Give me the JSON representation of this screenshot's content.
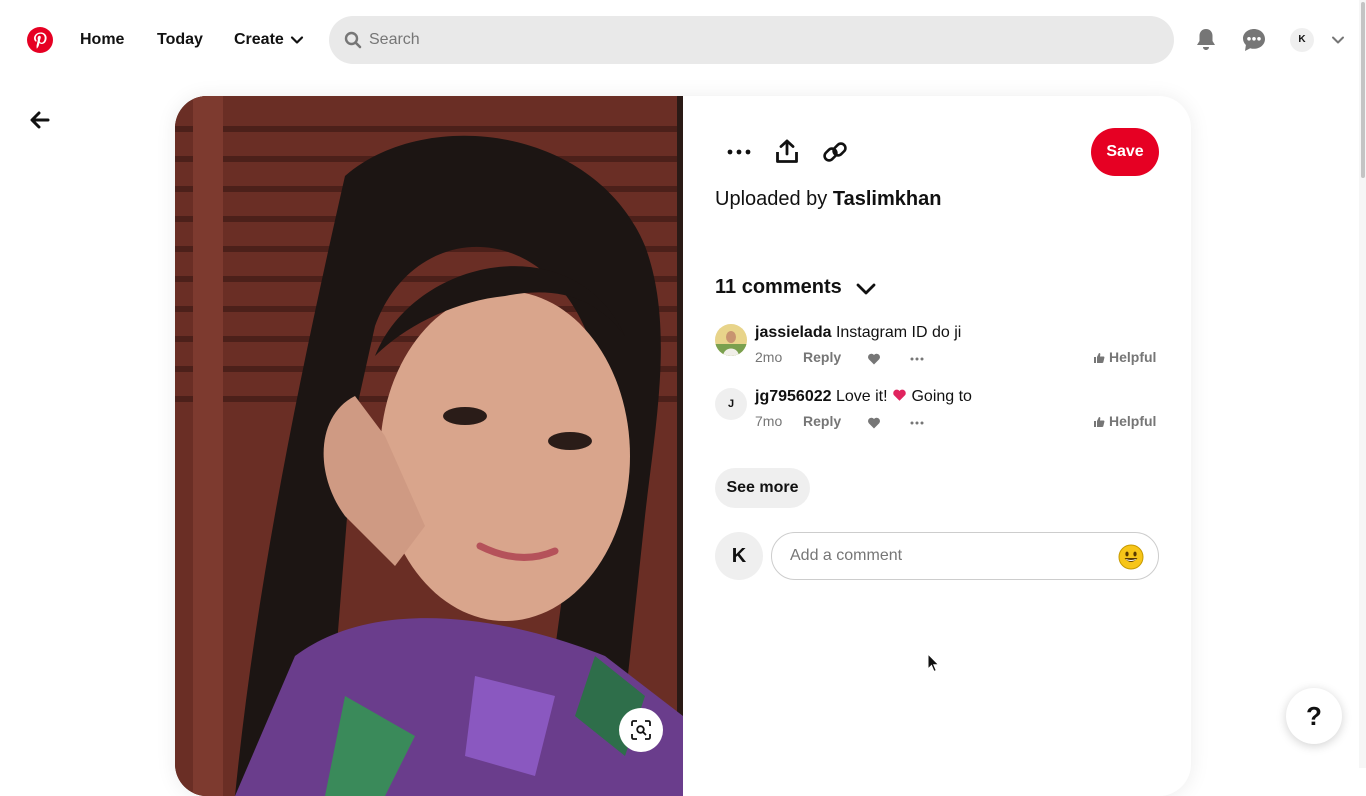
{
  "header": {
    "nav": {
      "home": "Home",
      "today": "Today",
      "create": "Create"
    },
    "search_placeholder": "Search",
    "account_initial": "K"
  },
  "pin": {
    "actions": {
      "save_label": "Save"
    },
    "uploaded_prefix": "Uploaded by",
    "uploader": "Taslimkhan",
    "comments_count_label": "11 comments",
    "comments": [
      {
        "user": "jassielada",
        "text": "Instagram ID do ji",
        "age": "2mo",
        "reply_label": "Reply",
        "helpful_label": "Helpful"
      },
      {
        "user": "jg7956022",
        "avatar_initial": "J",
        "text_before": "Love it!",
        "text_after": "Going to",
        "age": "7mo",
        "reply_label": "Reply",
        "helpful_label": "Helpful"
      }
    ],
    "see_more_label": "See more",
    "my_initial": "K",
    "comment_placeholder": "Add a comment"
  },
  "help_label": "?",
  "colors": {
    "brand": "#e60023",
    "search_bg": "#e9e9e9",
    "muted_text": "#767676"
  },
  "icons": [
    "pinterest-logo-icon",
    "chevron-down-icon",
    "search-icon",
    "bell-icon",
    "chat-icon",
    "back-arrow-icon",
    "more-icon",
    "share-icon",
    "link-icon",
    "heart-icon",
    "thumb-icon",
    "emoji-icon",
    "visual-search-icon"
  ]
}
